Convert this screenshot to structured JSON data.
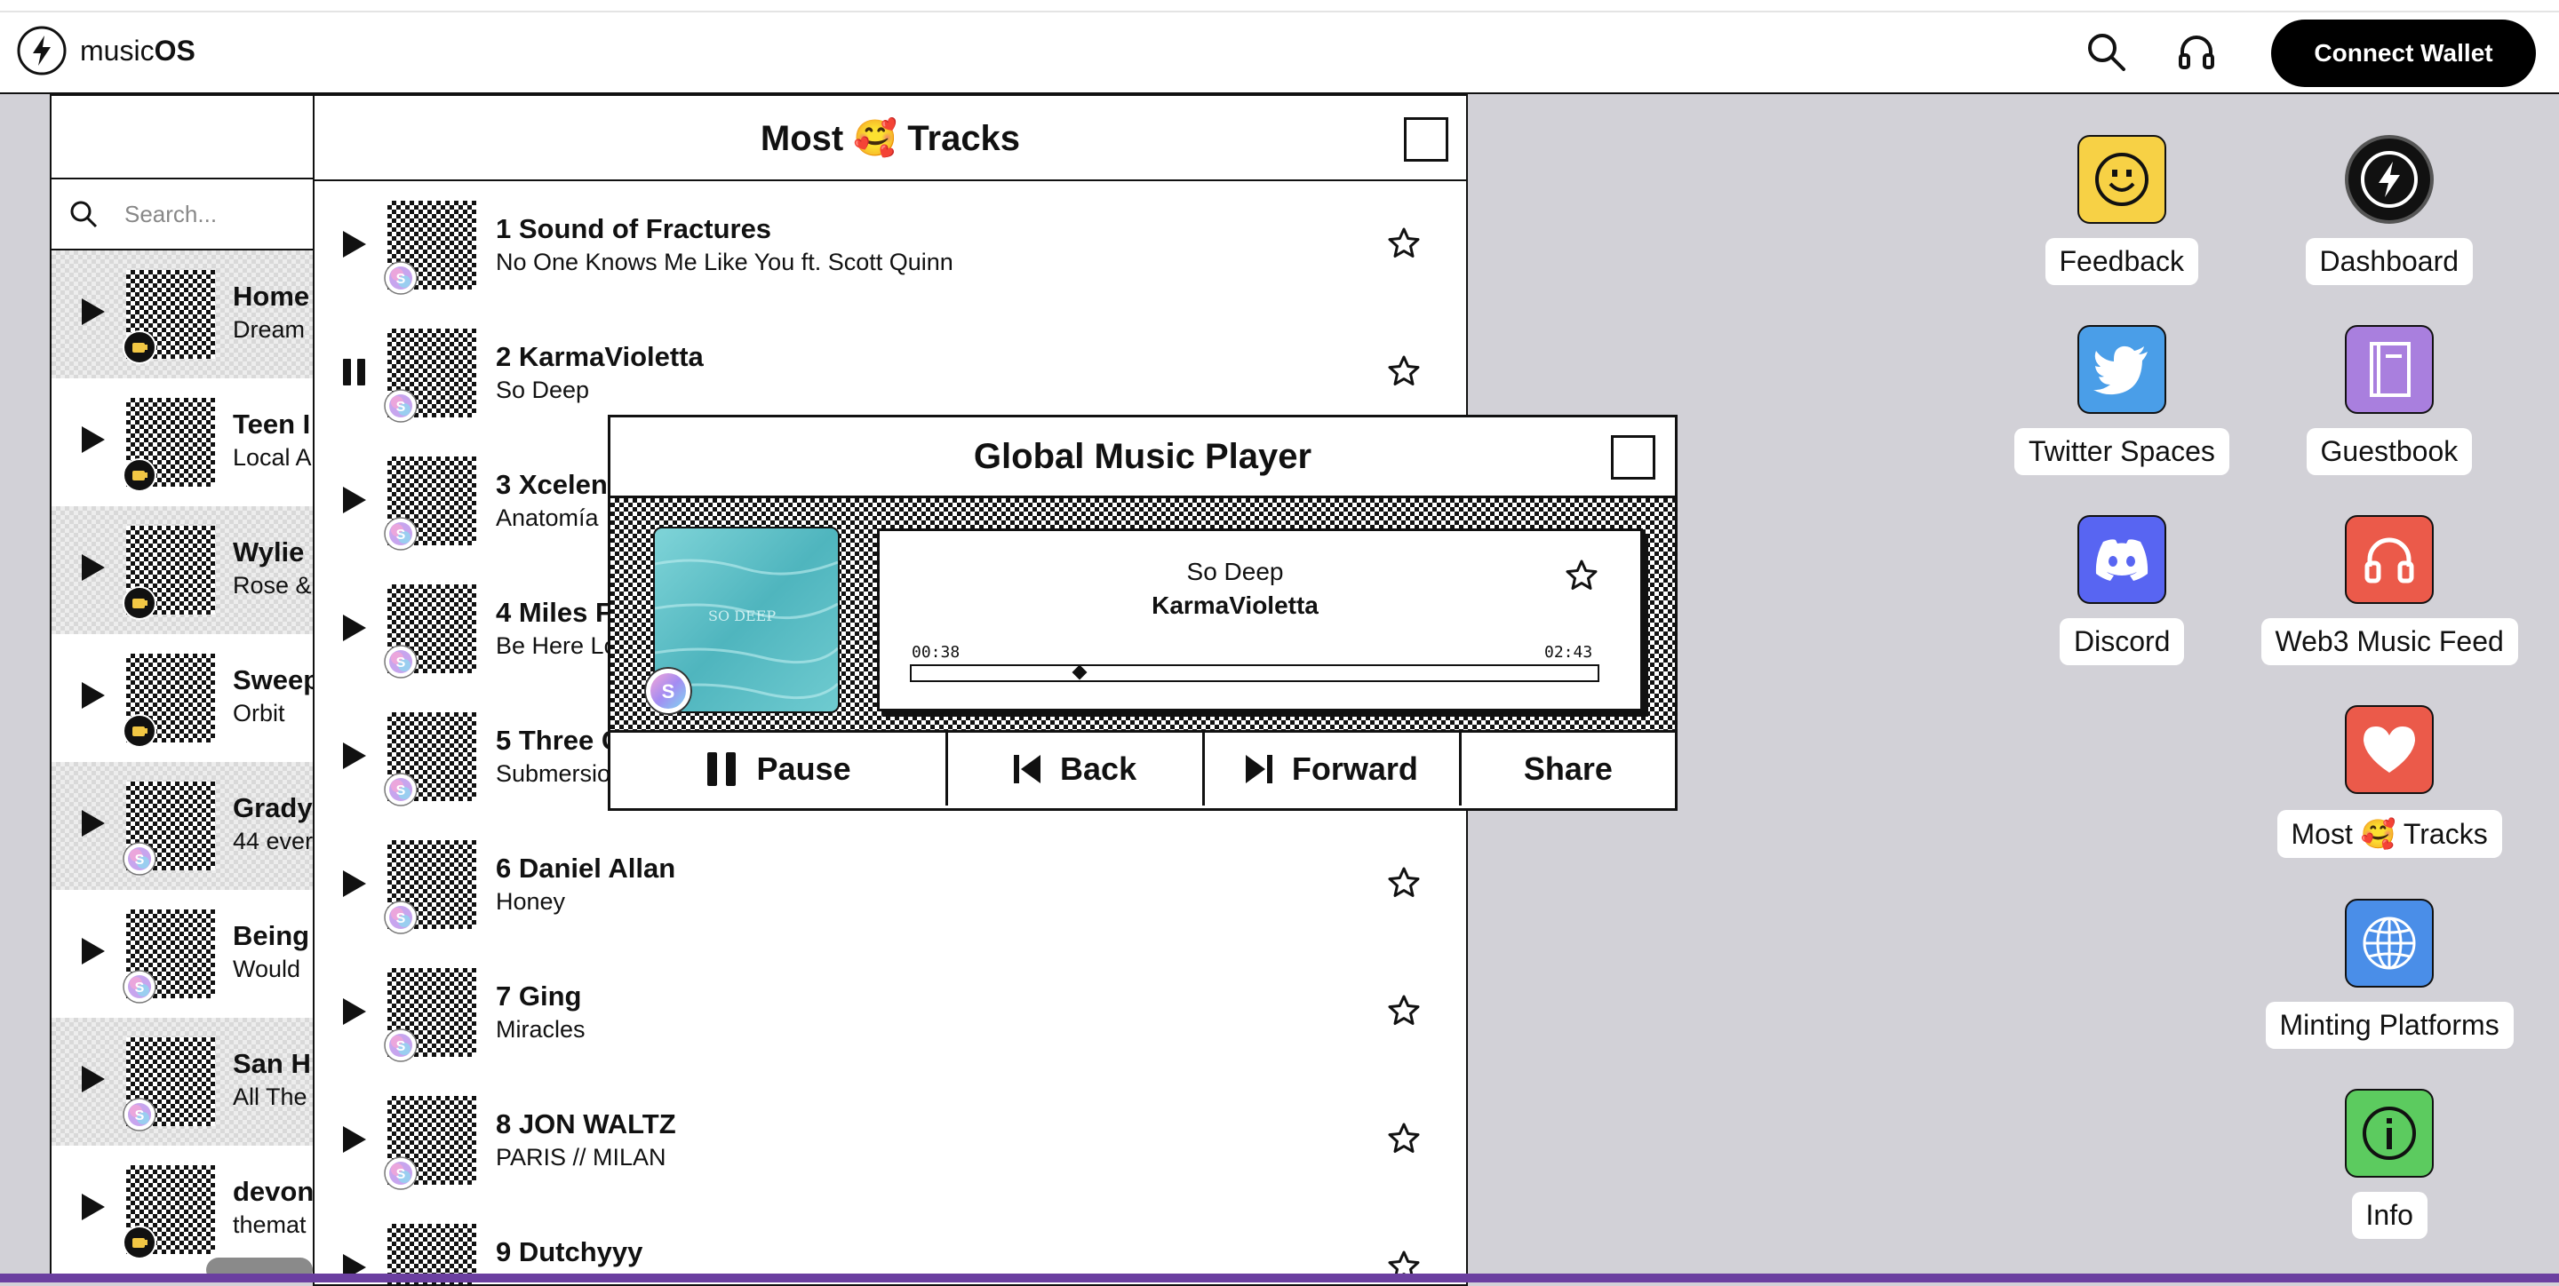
{
  "app": {
    "brand_prefix": "music",
    "brand_bold": "OS"
  },
  "topbar": {
    "connect_label": "Connect Wallet",
    "icons": [
      "search-icon",
      "headphones-icon"
    ]
  },
  "left_window": {
    "search_placeholder": "Search...",
    "items": [
      {
        "title": "Home",
        "subtitle": "Dream",
        "badge": "coin"
      },
      {
        "title": "Teen I",
        "subtitle": "Local A",
        "badge": "coin"
      },
      {
        "title": "Wylie",
        "subtitle": "Rose &",
        "badge": "coin"
      },
      {
        "title": "Sweep",
        "subtitle": "Orbit",
        "badge": "coin"
      },
      {
        "title": "Grady",
        "subtitle": "44 ever",
        "badge": "sound"
      },
      {
        "title": "Being",
        "subtitle": "Would",
        "badge": "sound"
      },
      {
        "title": "San H",
        "subtitle": "All The",
        "badge": "sound"
      },
      {
        "title": "devon",
        "subtitle": "themat",
        "badge": "coin"
      }
    ]
  },
  "tracks_window": {
    "title": "Most 🥰 Tracks",
    "tracks": [
      {
        "title": "1 Sound of Fractures",
        "subtitle": "No One Knows Me Like You ft. Scott Quinn",
        "state": "play"
      },
      {
        "title": "2 KarmaVioletta",
        "subtitle": "So Deep",
        "state": "pause"
      },
      {
        "title": "3 Xcelen",
        "subtitle": "Anatomía",
        "state": "play"
      },
      {
        "title": "4 Miles F",
        "subtitle": "Be Here Lo",
        "state": "play"
      },
      {
        "title": "5 Three C",
        "subtitle": "Submersio",
        "state": "play"
      },
      {
        "title": "6 Daniel Allan",
        "subtitle": "Honey",
        "state": "play"
      },
      {
        "title": "7 Ging",
        "subtitle": "Miracles",
        "state": "play"
      },
      {
        "title": "8 JON WALTZ",
        "subtitle": "PARIS // MILAN",
        "state": "play"
      },
      {
        "title": "9 Dutchyyy",
        "subtitle": "",
        "state": "play"
      }
    ]
  },
  "player": {
    "title": "Global Music Player",
    "song": "So Deep",
    "artist": "KarmaVioletta",
    "elapsed": "00:38",
    "duration": "02:43",
    "progress": 0.245,
    "art_text": "SO DEEP",
    "buttons": {
      "pause": "Pause",
      "back": "Back",
      "forward": "Forward",
      "share": "Share"
    }
  },
  "desktop": {
    "icons": [
      {
        "label": "Feedback",
        "icon": "smiley-icon",
        "color": "#f7d145"
      },
      {
        "label": "Dashboard",
        "icon": "bolt-icon",
        "color": "#111111"
      },
      {
        "label": "Twitter Spaces",
        "icon": "twitter-bird-icon",
        "color": "#4a9ee8"
      },
      {
        "label": "Guestbook",
        "icon": "book-icon",
        "color": "#a97fde"
      },
      {
        "label": "Discord",
        "icon": "discord-icon",
        "color": "#5865f2"
      },
      {
        "label": "Web3 Music Feed",
        "icon": "headphones-icon",
        "color": "#eb5a4a"
      },
      {
        "label": "Most 🥰 Tracks",
        "icon": "heart-icon",
        "color": "#eb5a4a"
      },
      {
        "label": "Minting Platforms",
        "icon": "globe-icon",
        "color": "#4a8ee8"
      },
      {
        "label": "Info",
        "icon": "info-icon",
        "color": "#5ccb5f"
      }
    ]
  }
}
